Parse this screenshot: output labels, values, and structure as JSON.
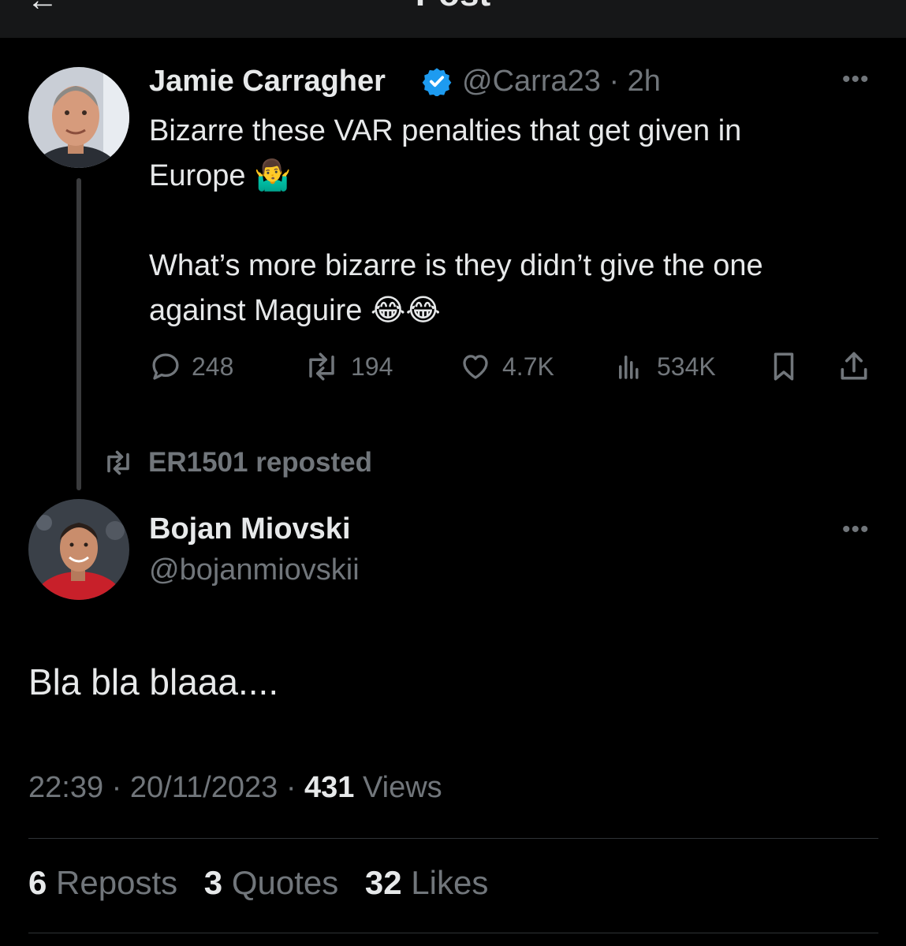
{
  "header": {
    "title": "Post"
  },
  "quoted_tweet": {
    "author_name": "Jamie Carragher",
    "handle": "@Carra23",
    "time": "2h",
    "text_line_1": "Bizarre these VAR penalties that get given in",
    "text_line_2": "Europe 🤷‍♂️",
    "text_line_3": "What’s more bizarre is they didn’t give the one",
    "text_line_4": "against Maguire 😂😂",
    "replies": "248",
    "reposts": "194",
    "likes": "4.7K",
    "views": "534K",
    "colors": {
      "verified": "#1d9bf0"
    }
  },
  "repost_label": "ER1501 reposted",
  "main_tweet": {
    "author_name": "Bojan Miovski",
    "handle": "@bojanmiovskii",
    "text": "Bla bla blaaa....",
    "time": "22:39",
    "date": "20/11/2023",
    "views_count": "431",
    "views_label": "Views",
    "reposts_count": "6",
    "reposts_label": "Reposts",
    "quotes_count": "3",
    "quotes_label": "Quotes",
    "likes_count": "32",
    "likes_label": "Likes"
  },
  "separator": "·"
}
